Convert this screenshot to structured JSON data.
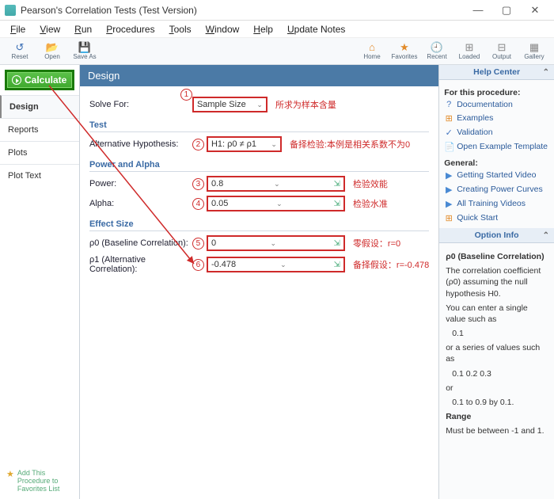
{
  "window": {
    "title": "Pearson's Correlation Tests (Test Version)"
  },
  "menu": [
    "File",
    "View",
    "Run",
    "Procedures",
    "Tools",
    "Window",
    "Help",
    "Update Notes"
  ],
  "toolbar_left": [
    {
      "icon": "↺",
      "label": "Reset",
      "cls": "blue"
    },
    {
      "icon": "📂",
      "label": "Open",
      "cls": ""
    },
    {
      "icon": "💾",
      "label": "Save As",
      "cls": "blue"
    }
  ],
  "toolbar_right": [
    {
      "icon": "⌂",
      "label": "Home",
      "cls": ""
    },
    {
      "icon": "★",
      "label": "Favorites",
      "cls": ""
    },
    {
      "icon": "🕘",
      "label": "Recent",
      "cls": "gray"
    },
    {
      "icon": "⊞",
      "label": "Loaded",
      "cls": "gray"
    },
    {
      "icon": "⊟",
      "label": "Output",
      "cls": "gray"
    },
    {
      "icon": "▦",
      "label": "Gallery",
      "cls": "gray"
    }
  ],
  "calculate_label": "Calculate",
  "nav": [
    {
      "label": "Design",
      "active": true
    },
    {
      "label": "Reports",
      "active": false
    },
    {
      "label": "Plots",
      "active": false
    },
    {
      "label": "Plot Text",
      "active": false
    }
  ],
  "fav_note": "Add This Procedure to Favorites List",
  "design": {
    "title": "Design",
    "solve_for_label": "Solve For:",
    "solve_for_value": "Sample Size",
    "solve_for_annot": "所求为样本含量",
    "test_section": "Test",
    "alt_hyp_label": "Alternative Hypothesis:",
    "alt_hyp_value": "H1: ρ0 ≠ ρ1",
    "alt_hyp_annot": "备择检验:本例是相关系数不为0",
    "power_alpha_section": "Power and Alpha",
    "power_label": "Power:",
    "power_value": "0.8",
    "power_annot": "检验效能",
    "alpha_label": "Alpha:",
    "alpha_value": "0.05",
    "alpha_annot": "检验水准",
    "effect_section": "Effect Size",
    "rho0_label": "ρ0 (Baseline Correlation):",
    "rho0_value": "0",
    "rho0_annot": "零假设：r=0",
    "rho1_label": "ρ1 (Alternative Correlation):",
    "rho1_value": "-0.478",
    "rho1_annot": "备择假设：r=-0.478",
    "badges": [
      "1",
      "2",
      "3",
      "4",
      "5",
      "6"
    ]
  },
  "help": {
    "title": "Help Center",
    "for_this": "For this procedure:",
    "items1": [
      {
        "icon": "?",
        "cls": "blue",
        "label": "Documentation"
      },
      {
        "icon": "⊞",
        "cls": "orange",
        "label": "Examples"
      },
      {
        "icon": "✓",
        "cls": "blue",
        "label": "Validation"
      },
      {
        "icon": "📄",
        "cls": "orange",
        "label": "Open Example Template"
      }
    ],
    "general": "General:",
    "items2": [
      {
        "icon": "▶",
        "cls": "play",
        "label": "Getting Started Video"
      },
      {
        "icon": "▶",
        "cls": "play",
        "label": "Creating Power Curves"
      },
      {
        "icon": "▶",
        "cls": "play",
        "label": "All Training Videos"
      },
      {
        "icon": "⊞",
        "cls": "orange",
        "label": "Quick Start"
      }
    ]
  },
  "option": {
    "title": "Option Info",
    "heading": "ρ0 (Baseline Correlation)",
    "p1": "The correlation coefficient (ρ0) assuming the null hypothesis H0.",
    "p2": "You can enter a single value such as",
    "v1": "0.1",
    "p3": "or a series of values such as",
    "v2": "0.1 0.2 0.3",
    "p4": "or",
    "v3": "0.1 to 0.9 by 0.1.",
    "range_h": "Range",
    "range_t": "Must be between -1 and 1."
  }
}
